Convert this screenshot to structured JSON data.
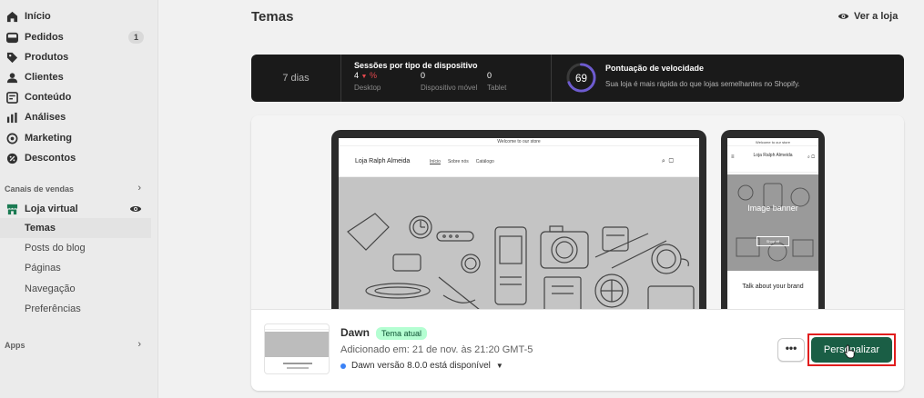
{
  "sidebar": {
    "items": [
      {
        "label": "Início",
        "icon": "home-icon"
      },
      {
        "label": "Pedidos",
        "icon": "orders-icon",
        "badge": "1"
      },
      {
        "label": "Produtos",
        "icon": "tag-icon"
      },
      {
        "label": "Clientes",
        "icon": "person-icon"
      },
      {
        "label": "Conteúdo",
        "icon": "content-icon"
      },
      {
        "label": "Análises",
        "icon": "chart-icon"
      },
      {
        "label": "Marketing",
        "icon": "target-icon"
      },
      {
        "label": "Descontos",
        "icon": "discount-icon"
      }
    ],
    "sales_channels_label": "Canais de vendas",
    "online_store": {
      "label": "Loja virtual",
      "subitems": [
        "Temas",
        "Posts do blog",
        "Páginas",
        "Navegação",
        "Preferências"
      ]
    },
    "apps_label": "Apps"
  },
  "header": {
    "title": "Temas",
    "view_store": "Ver a loja"
  },
  "stats": {
    "period": "7 dias",
    "sessions_title": "Sessões por tipo de dispositivo",
    "desktop_value": "4",
    "desktop_change": "%",
    "desktop_label": "Desktop",
    "mobile_value": "0",
    "mobile_label": "Dispositivo móvel",
    "tablet_value": "0",
    "tablet_label": "Tablet",
    "speed_score": "69",
    "speed_score_fraction": 0.69,
    "speed_title": "Pontuação de velocidade",
    "speed_desc": "Sua loja é mais rápida do que lojas semelhantes no Shopify."
  },
  "preview": {
    "announcement": "Welcome to our store",
    "shop_name": "Loja Ralph Almeida",
    "links": [
      "Início",
      "Sobre nós",
      "Catálogo"
    ],
    "phone_shop_name": "Loja Ralph Almeida",
    "banner_title": "Image banner",
    "banner_button": "Shop all",
    "phone_text": "Talk about your brand"
  },
  "theme": {
    "name": "Dawn",
    "badge": "Tema atual",
    "added": "Adicionado em: 21 de nov. às 21:20 GMT-5",
    "version": "Dawn versão 8.0.0 está disponível",
    "more_label": "•••",
    "customize_label": "Personalizar"
  },
  "colors": {
    "accent": "#1a5e45",
    "highlight": "#e11d1d",
    "stats_bg": "#1a1a1a",
    "badge_bg": "#b4fed2"
  }
}
